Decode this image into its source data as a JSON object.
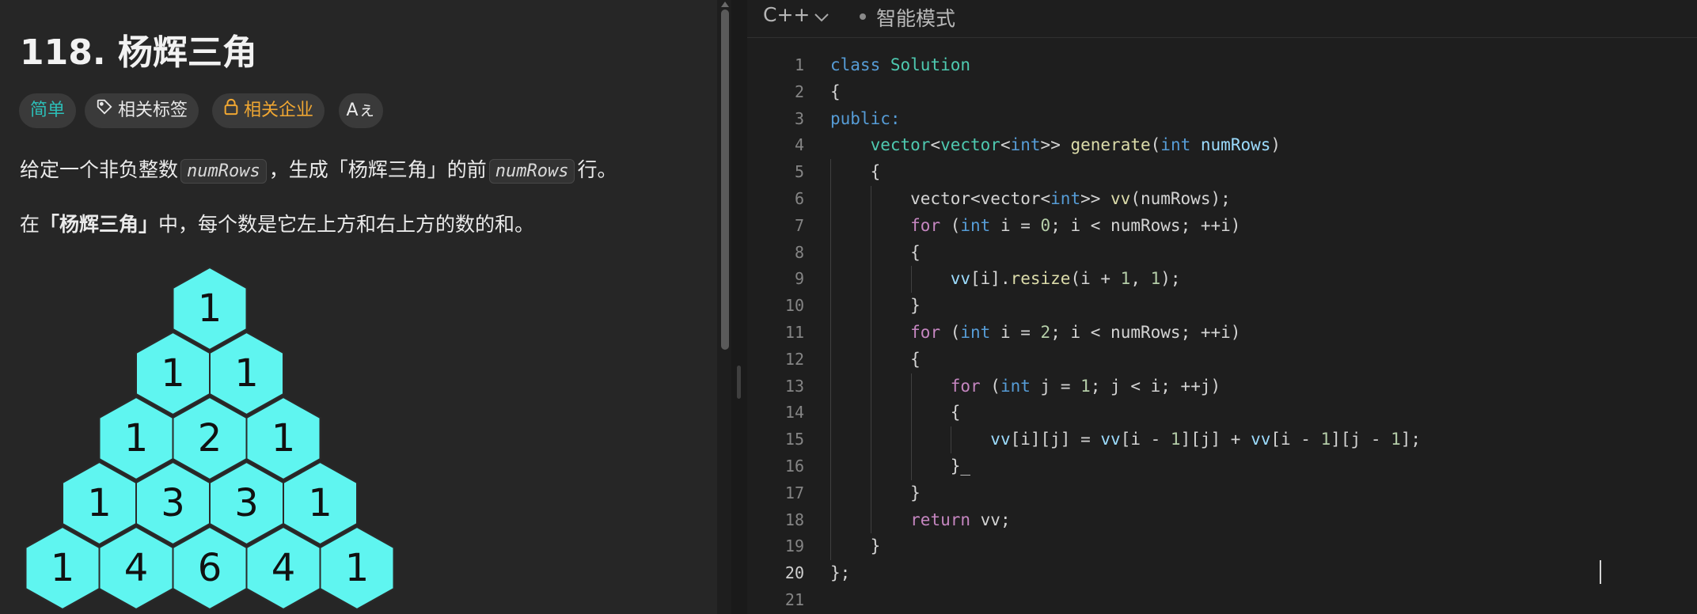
{
  "problem": {
    "title": "118. 杨辉三角",
    "tags": {
      "difficulty": "简单",
      "topics": "相关标签",
      "companies": "相关企业",
      "translate": "Aぇ"
    },
    "desc1_prefix": "给定一个非负整数",
    "desc1_code": "numRows",
    "desc1_mid": "，生成「杨辉三角」的前",
    "desc1_code2": "numRows",
    "desc1_suffix": "行。",
    "desc2_prefix": "在",
    "desc2_bold": "「杨辉三角」",
    "desc2_suffix": "中，每个数是它左上方和右上方的数的和。",
    "triangle": [
      [
        1
      ],
      [
        1,
        1
      ],
      [
        1,
        2,
        1
      ],
      [
        1,
        3,
        3,
        1
      ],
      [
        1,
        4,
        6,
        4,
        1
      ]
    ],
    "hex_color": "#5ff5f0"
  },
  "editor": {
    "language": "C++",
    "mode": "智能模式",
    "current_line": 20,
    "lines": [
      {
        "n": 1,
        "tokens": [
          [
            "kw",
            "class"
          ],
          [
            "pl",
            " "
          ],
          [
            "ty",
            "Solution"
          ]
        ]
      },
      {
        "n": 2,
        "tokens": [
          [
            "pl",
            "{"
          ]
        ]
      },
      {
        "n": 3,
        "tokens": [
          [
            "kw",
            "public:"
          ]
        ]
      },
      {
        "n": 4,
        "tokens": [
          [
            "pl",
            "    "
          ],
          [
            "ty",
            "vector"
          ],
          [
            "pl",
            "<"
          ],
          [
            "ty",
            "vector"
          ],
          [
            "pl",
            "<"
          ],
          [
            "kw",
            "int"
          ],
          [
            "pl",
            ">> "
          ],
          [
            "fn",
            "generate"
          ],
          [
            "pl",
            "("
          ],
          [
            "kw",
            "int"
          ],
          [
            "pl",
            " "
          ],
          [
            "var",
            "numRows"
          ],
          [
            "pl",
            ")"
          ]
        ]
      },
      {
        "n": 5,
        "tokens": [
          [
            "pl",
            "    {"
          ]
        ]
      },
      {
        "n": 6,
        "tokens": [
          [
            "pl",
            "        vector<vector<"
          ],
          [
            "kw",
            "int"
          ],
          [
            "pl",
            ">> "
          ],
          [
            "fn",
            "vv"
          ],
          [
            "pl",
            "(numRows);"
          ]
        ]
      },
      {
        "n": 7,
        "tokens": [
          [
            "pl",
            "        "
          ],
          [
            "ctl",
            "for"
          ],
          [
            "pl",
            " ("
          ],
          [
            "kw",
            "int"
          ],
          [
            "pl",
            " i = "
          ],
          [
            "num",
            "0"
          ],
          [
            "pl",
            "; i < numRows; ++i)"
          ]
        ]
      },
      {
        "n": 8,
        "tokens": [
          [
            "pl",
            "        {"
          ]
        ]
      },
      {
        "n": 9,
        "tokens": [
          [
            "pl",
            "            "
          ],
          [
            "var",
            "vv"
          ],
          [
            "pl",
            "[i]."
          ],
          [
            "fn",
            "resize"
          ],
          [
            "pl",
            "(i + "
          ],
          [
            "num",
            "1"
          ],
          [
            "pl",
            ", "
          ],
          [
            "num",
            "1"
          ],
          [
            "pl",
            ");"
          ]
        ]
      },
      {
        "n": 10,
        "tokens": [
          [
            "pl",
            "        }"
          ]
        ]
      },
      {
        "n": 11,
        "tokens": [
          [
            "pl",
            "        "
          ],
          [
            "ctl",
            "for"
          ],
          [
            "pl",
            " ("
          ],
          [
            "kw",
            "int"
          ],
          [
            "pl",
            " i = "
          ],
          [
            "num",
            "2"
          ],
          [
            "pl",
            "; i < numRows; ++i)"
          ]
        ]
      },
      {
        "n": 12,
        "tokens": [
          [
            "pl",
            "        {"
          ]
        ]
      },
      {
        "n": 13,
        "tokens": [
          [
            "pl",
            "            "
          ],
          [
            "ctl",
            "for"
          ],
          [
            "pl",
            " ("
          ],
          [
            "kw",
            "int"
          ],
          [
            "pl",
            " j = "
          ],
          [
            "num",
            "1"
          ],
          [
            "pl",
            "; j < i; ++j)"
          ]
        ]
      },
      {
        "n": 14,
        "tokens": [
          [
            "pl",
            "            {"
          ]
        ]
      },
      {
        "n": 15,
        "tokens": [
          [
            "pl",
            "                "
          ],
          [
            "var",
            "vv"
          ],
          [
            "pl",
            "[i][j] = "
          ],
          [
            "var",
            "vv"
          ],
          [
            "pl",
            "[i - "
          ],
          [
            "num",
            "1"
          ],
          [
            "pl",
            "][j] + "
          ],
          [
            "var",
            "vv"
          ],
          [
            "pl",
            "[i - "
          ],
          [
            "num",
            "1"
          ],
          [
            "pl",
            "][j - "
          ],
          [
            "num",
            "1"
          ],
          [
            "pl",
            "];"
          ]
        ]
      },
      {
        "n": 16,
        "tokens": [
          [
            "pl",
            "            }_"
          ]
        ]
      },
      {
        "n": 17,
        "tokens": [
          [
            "pl",
            "        }"
          ]
        ]
      },
      {
        "n": 18,
        "tokens": [
          [
            "pl",
            "        "
          ],
          [
            "ctl",
            "return"
          ],
          [
            "pl",
            " vv;"
          ]
        ]
      },
      {
        "n": 19,
        "tokens": [
          [
            "pl",
            "    }"
          ]
        ]
      },
      {
        "n": 20,
        "tokens": [
          [
            "pl",
            "};"
          ]
        ]
      },
      {
        "n": 21,
        "tokens": []
      }
    ]
  }
}
